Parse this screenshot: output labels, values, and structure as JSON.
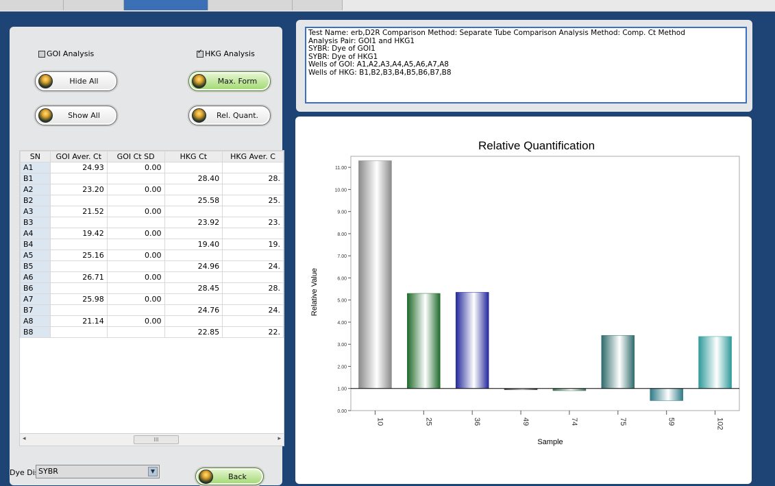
{
  "left": {
    "goi_checkbox": "GOI Analysis",
    "goi_checked": false,
    "hkg_checkbox": "HKG Analysis",
    "hkg_checked": true,
    "buttons": {
      "hide_all": "Hide All",
      "show_all": "Show All",
      "max_form": "Max. Form",
      "rel_quant": "Rel. Quant.",
      "back": "Back"
    }
  },
  "table": {
    "columns": [
      "SN",
      "GOI Aver. Ct",
      "GOI Ct SD",
      "HKG Ct",
      "HKG Aver. C"
    ],
    "rows": [
      [
        "A1",
        "24.93",
        "0.00",
        "",
        ""
      ],
      [
        "B1",
        "",
        "",
        "28.40",
        "28."
      ],
      [
        "A2",
        "23.20",
        "0.00",
        "",
        ""
      ],
      [
        "B2",
        "",
        "",
        "25.58",
        "25."
      ],
      [
        "A3",
        "21.52",
        "0.00",
        "",
        ""
      ],
      [
        "B3",
        "",
        "",
        "23.92",
        "23."
      ],
      [
        "A4",
        "19.42",
        "0.00",
        "",
        ""
      ],
      [
        "B4",
        "",
        "",
        "19.40",
        "19."
      ],
      [
        "A5",
        "25.16",
        "0.00",
        "",
        ""
      ],
      [
        "B5",
        "",
        "",
        "24.96",
        "24."
      ],
      [
        "A6",
        "26.71",
        "0.00",
        "",
        ""
      ],
      [
        "B6",
        "",
        "",
        "28.45",
        "28."
      ],
      [
        "A7",
        "25.98",
        "0.00",
        "",
        ""
      ],
      [
        "B7",
        "",
        "",
        "24.76",
        "24."
      ],
      [
        "A8",
        "21.14",
        "0.00",
        "",
        ""
      ],
      [
        "B8",
        "",
        "",
        "22.85",
        "22."
      ]
    ],
    "scroll_thumb": "III"
  },
  "dye": {
    "label": "Dye Disp.",
    "value": "SYBR"
  },
  "info": {
    "lines": [
      "Test Name: erb,D2R   Comparison Method: Separate Tube Comparison   Analysis Method: Comp. Ct Method",
      "Analysis Pair: GOI1 and HKG1",
      "SYBR: Dye of GOI1",
      "SYBR: Dye of HKG1",
      "Wells of GOI: A1,A2,A3,A4,A5,A6,A7,A8",
      "Wells of HKG: B1,B2,B3,B4,B5,B6,B7,B8"
    ]
  },
  "chart_data": {
    "type": "bar",
    "title": "Relative Quantification",
    "xlabel": "Sample",
    "ylabel": "Relative Value",
    "categories": [
      "10",
      "25",
      "36",
      "49",
      "74",
      "75",
      "59",
      "102"
    ],
    "values": [
      11.3,
      5.3,
      5.35,
      1.0,
      0.9,
      3.4,
      0.45,
      3.35
    ],
    "baseline": 1.0,
    "ylim": [
      0.0,
      11.5
    ],
    "yticks": [
      "0.00",
      "1.00",
      "2.00",
      "3.00",
      "4.00",
      "5.00",
      "6.00",
      "7.00",
      "8.00",
      "9.00",
      "10.00",
      "11.00"
    ],
    "colors": [
      "#8a8a8a",
      "#1f6a2a",
      "#23279a",
      "#4c4c4c",
      "#3f6f55",
      "#2f6a6a",
      "#2f7a86",
      "#2f9a9a"
    ]
  }
}
